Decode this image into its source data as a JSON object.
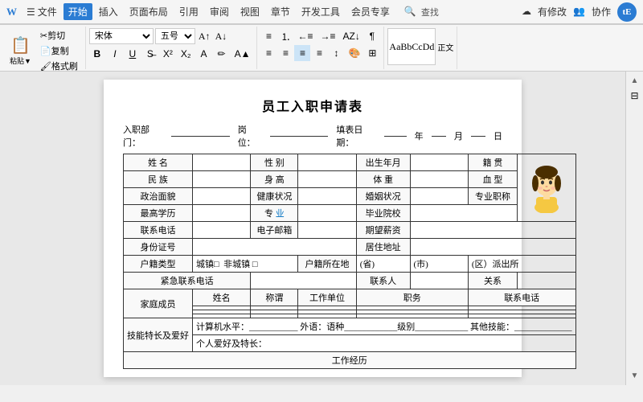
{
  "titlebar": {
    "menu_items": [
      "文件",
      "插入",
      "页面布局",
      "引用",
      "审阅",
      "视图",
      "章节",
      "开发工具",
      "会员专享"
    ],
    "active_tab": "开始",
    "search_placeholder": "查找",
    "cloud_status": "有修改",
    "collab": "协作",
    "user_badge": "tE"
  },
  "ribbon": {
    "paste_label": "粘贴▼",
    "cut_label": "剪切",
    "copy_label": "复制",
    "format_brush": "格式刷",
    "font_name": "宋体",
    "font_size": "五号",
    "bold": "B",
    "italic": "I",
    "underline": "U",
    "style_label": "正文",
    "style_preview": "AaBbCcDd"
  },
  "document": {
    "title": "员工入职申请表",
    "header": {
      "dept_label": "入职部门：",
      "position_label": "岗位：",
      "fill_date_label": "填表日期：",
      "year_label": "年",
      "month_label": "月",
      "day_label": "日"
    },
    "table": {
      "rows": [
        {
          "cells": [
            {
              "label": "姓 名",
              "value": "",
              "colspan": 1
            },
            {
              "label": "性 别",
              "value": "",
              "colspan": 1
            },
            {
              "label": "出生年月",
              "value": "",
              "colspan": 1
            },
            {
              "label": "籍 贯",
              "value": "",
              "colspan": 1,
              "has_avatar": true
            }
          ]
        },
        {
          "cells": [
            {
              "label": "民 族",
              "value": "",
              "colspan": 1
            },
            {
              "label": "身 高",
              "value": "",
              "colspan": 1
            },
            {
              "label": "体 重",
              "value": "",
              "colspan": 1
            },
            {
              "label": "血 型",
              "value": ""
            }
          ]
        },
        {
          "cells": [
            {
              "label": "政治面貌",
              "value": "",
              "colspan": 1
            },
            {
              "label": "健康状况",
              "value": "",
              "colspan": 1
            },
            {
              "label": "婚姻状况",
              "value": "",
              "colspan": 1
            },
            {
              "label": "专业职称",
              "value": ""
            }
          ]
        },
        {
          "cells": [
            {
              "label": "最高学历",
              "value": "",
              "colspan": 1
            },
            {
              "label": "专 业",
              "value": "",
              "colspan": 1,
              "link": true
            },
            {
              "label": "毕业院校",
              "value": "",
              "colspan": 2
            }
          ]
        },
        {
          "cells": [
            {
              "label": "联系电话",
              "value": "",
              "colspan": 1
            },
            {
              "label": "电子邮箱",
              "value": "",
              "colspan": 1
            },
            {
              "label": "期望薪资",
              "value": "",
              "colspan": 2
            }
          ]
        },
        {
          "cells": [
            {
              "label": "身份证号",
              "value": "",
              "colspan": 1
            },
            {
              "label": "居住地址",
              "value": "",
              "colspan": 3
            }
          ]
        },
        {
          "cells": [
            {
              "label": "户籍类型",
              "value": "城镇□  非城镇 □",
              "colspan": 1,
              "is_checkbox": true
            },
            {
              "label": "户籍所在地",
              "value": "",
              "colspan": 1
            },
            {
              "label": "(省)",
              "value": "",
              "colspan": 1
            },
            {
              "label": "(市)",
              "value": "",
              "colspan": 1
            },
            {
              "label": "(区）派出所",
              "value": "",
              "colspan": 1
            }
          ]
        },
        {
          "cells": [
            {
              "label": "紧急联系电话",
              "value": "",
              "colspan": 2
            },
            {
              "label": "联系人",
              "value": "",
              "colspan": 1
            },
            {
              "label": "关系",
              "value": "",
              "colspan": 1
            }
          ]
        },
        {
          "header_row": true,
          "cells": [
            {
              "label": "",
              "value": "",
              "colspan": 1
            },
            {
              "label": "姓名",
              "value": "",
              "colspan": 1
            },
            {
              "label": "称谓",
              "value": "",
              "colspan": 1
            },
            {
              "label": "工作单位",
              "value": "",
              "colspan": 1
            },
            {
              "label": "职务",
              "value": "",
              "colspan": 1
            },
            {
              "label": "联系电话",
              "value": "",
              "colspan": 1
            }
          ]
        },
        {
          "family_row": true,
          "label": "家庭成员",
          "sub_rows": 3
        },
        {
          "skills_row": true,
          "label": "技能特长及爱好",
          "content": "计算机水平：___________  外语：语种____________级别____________  其他技能：_____________",
          "content2": "个人爱好及特长："
        }
      ]
    },
    "work_history_label": "工作经历"
  }
}
